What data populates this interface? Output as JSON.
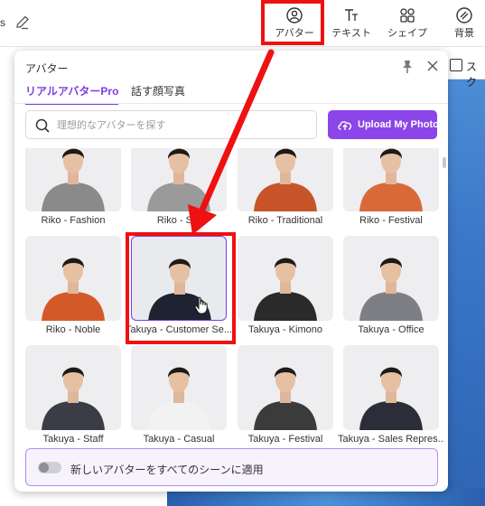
{
  "topbar": {
    "left_fragment": "s",
    "tools": [
      {
        "label": "アバター",
        "icon": "avatar-icon"
      },
      {
        "label": "テキスト",
        "icon": "text-icon"
      },
      {
        "label": "シェイプ",
        "icon": "shapes-icon"
      },
      {
        "label": "背景",
        "icon": "background-icon"
      }
    ]
  },
  "stage": {
    "partial_label": "スク"
  },
  "panel": {
    "title": "アバター",
    "tabs": [
      {
        "label": "リアルアバターPro",
        "active": true
      },
      {
        "label": "話す顔写真",
        "active": false
      }
    ],
    "search": {
      "placeholder": "理想的なアバターを探す",
      "value": ""
    },
    "upload_button": "Upload My Photo",
    "avatars": [
      {
        "label": "Riko - Fashion",
        "outfit": "#8a8a8a"
      },
      {
        "label": "Riko - Stu",
        "outfit": "#9a9a9a"
      },
      {
        "label": "Riko - Traditional",
        "outfit": "#c8552a"
      },
      {
        "label": "Riko - Festival",
        "outfit": "#d86a3a"
      },
      {
        "label": "Riko - Noble",
        "outfit": "#d35a28"
      },
      {
        "label": "Takuya - Customer Se...",
        "outfit": "#1f2230",
        "selected": true
      },
      {
        "label": "Takuya - Kimono",
        "outfit": "#2a2a2a"
      },
      {
        "label": "Takuya - Office",
        "outfit": "#7d7f85"
      },
      {
        "label": "Takuya - Staff",
        "outfit": "#3a3d45"
      },
      {
        "label": "Takuya - Casual",
        "outfit": "#f2f2f2"
      },
      {
        "label": "Takuya - Festival",
        "outfit": "#3b3b3b"
      },
      {
        "label": "Takuya - Sales Repres...",
        "outfit": "#2b2e38"
      }
    ],
    "apply_all": {
      "label": "新しいアバターをすべてのシーンに適用",
      "enabled": false
    }
  },
  "colors": {
    "accent": "#7b3fe4",
    "button": "#8b45e8",
    "annotation": "#ee1111"
  }
}
